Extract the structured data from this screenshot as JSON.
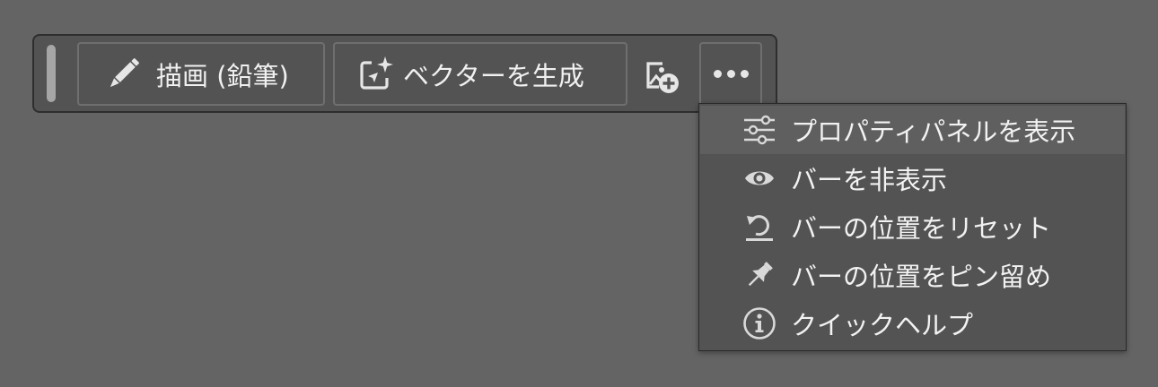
{
  "taskbar": {
    "grip_icon": "drag-handle",
    "draw_button": {
      "icon": "pencil-icon",
      "label": "描画 (鉛筆)"
    },
    "vector_button": {
      "icon": "generate-vector-icon",
      "label": "ベクターを生成"
    },
    "add_image_icon": "image-add-icon",
    "more_button": {
      "icon": "more-horizontal-icon"
    }
  },
  "menu": {
    "items": [
      {
        "icon": "sliders-icon",
        "label": "プロパティパネルを表示",
        "highlighted": true
      },
      {
        "icon": "eye-icon",
        "label": "バーを非表示"
      },
      {
        "icon": "reset-icon",
        "label": "バーの位置をリセット"
      },
      {
        "icon": "pin-icon",
        "label": "バーの位置をピン留め"
      },
      {
        "icon": "info-icon",
        "label": "クイックヘルプ"
      }
    ]
  },
  "colors": {
    "canvas": "#646464",
    "bar": "#535353",
    "menu_hover": "#5f5f5f",
    "text": "#f2f2f2",
    "icon": "#d9d9d9"
  }
}
